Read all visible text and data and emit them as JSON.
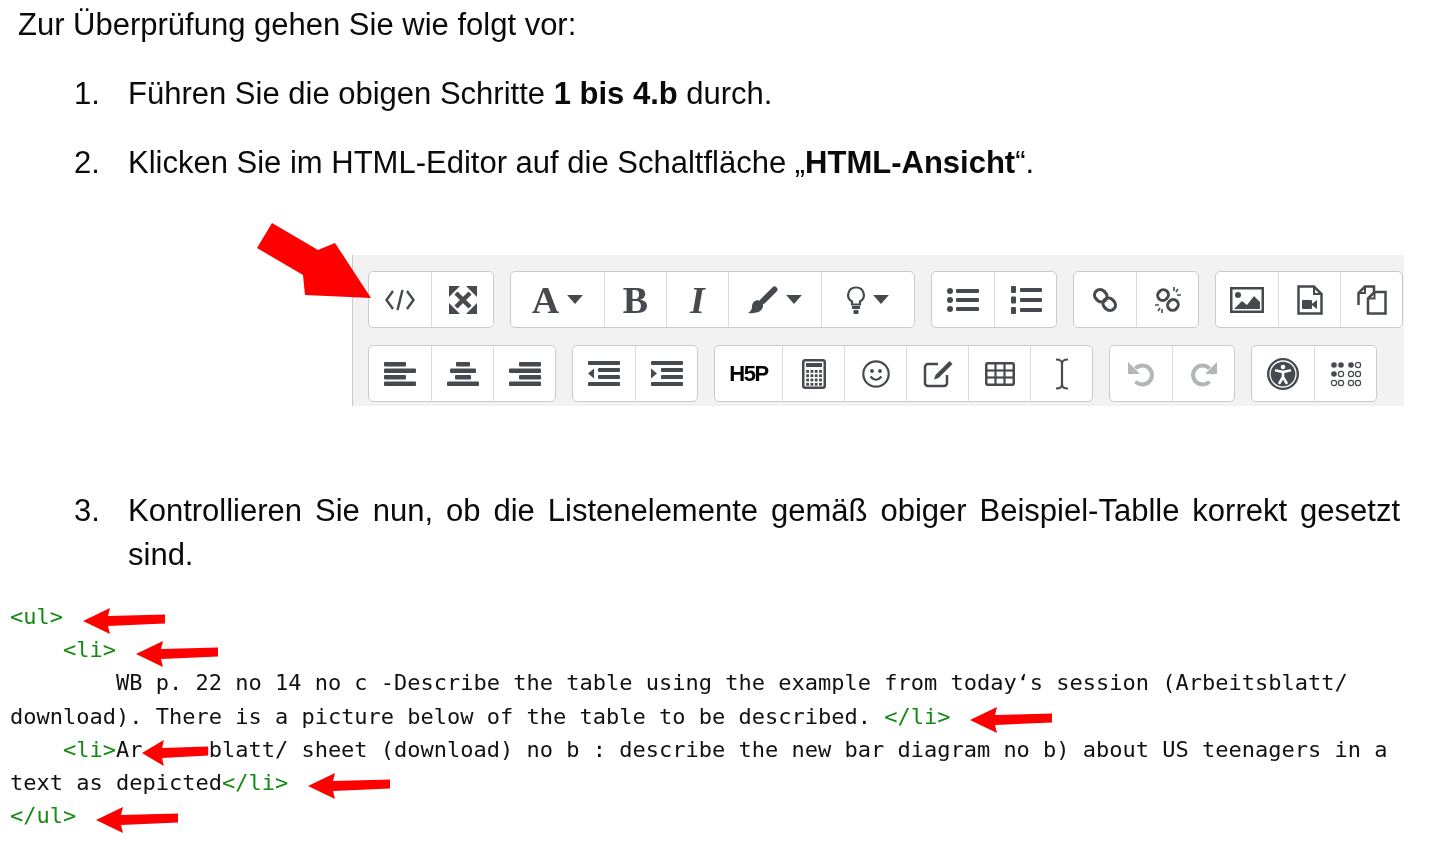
{
  "heading": "Zur Überprüfung gehen Sie wie folgt vor:",
  "steps": [
    {
      "number": "1.",
      "text": "Führen Sie die obigen Schritte **1 bis 4.b** durch."
    },
    {
      "number": "2.",
      "text": "Klicken Sie im HTML-Editor auf die Schaltfläche „**HTML-Ansicht**“.",
      "toolbar": {
        "rows": [
          {
            "groups": [
              {
                "buttons": [
                  {
                    "kind": "icon",
                    "dropdown": false,
                    "disabled": false
                  },
                  {
                    "kind": "icon",
                    "dropdown": false,
                    "disabled": false
                  }
                ]
              },
              {
                "buttons": [
                  {
                    "kind": "glyph",
                    "label": "A",
                    "dropdown": true,
                    "disabled": false
                  },
                  {
                    "kind": "glyph",
                    "label": "B",
                    "dropdown": false,
                    "disabled": false
                  },
                  {
                    "kind": "glyph",
                    "label": "I",
                    "dropdown": false,
                    "disabled": false
                  },
                  {
                    "kind": "icon",
                    "dropdown": true,
                    "disabled": false
                  },
                  {
                    "kind": "icon",
                    "dropdown": true,
                    "disabled": false
                  }
                ]
              },
              {
                "buttons": [
                  {
                    "kind": "icon",
                    "dropdown": false,
                    "disabled": false
                  },
                  {
                    "kind": "icon",
                    "dropdown": false,
                    "disabled": false
                  }
                ]
              },
              {
                "buttons": [
                  {
                    "kind": "icon",
                    "dropdown": false,
                    "disabled": false
                  },
                  {
                    "kind": "icon",
                    "dropdown": false,
                    "disabled": false
                  }
                ]
              },
              {
                "buttons": [
                  {
                    "kind": "icon",
                    "dropdown": false,
                    "disabled": false
                  },
                  {
                    "kind": "icon",
                    "dropdown": false,
                    "disabled": false
                  },
                  {
                    "kind": "icon",
                    "dropdown": false,
                    "disabled": false
                  }
                ]
              }
            ]
          },
          {
            "groups": [
              {
                "buttons": [
                  {
                    "kind": "icon",
                    "dropdown": false,
                    "disabled": false
                  },
                  {
                    "kind": "icon",
                    "dropdown": false,
                    "disabled": false
                  },
                  {
                    "kind": "icon",
                    "dropdown": false,
                    "disabled": false
                  }
                ]
              },
              {
                "buttons": [
                  {
                    "kind": "icon",
                    "dropdown": false,
                    "disabled": false
                  },
                  {
                    "kind": "icon",
                    "dropdown": false,
                    "disabled": false
                  }
                ]
              },
              {
                "buttons": [
                  {
                    "kind": "glyph",
                    "label": "H5P",
                    "dropdown": false,
                    "disabled": false
                  },
                  {
                    "kind": "icon",
                    "dropdown": false,
                    "disabled": false
                  },
                  {
                    "kind": "icon",
                    "dropdown": false,
                    "disabled": false
                  },
                  {
                    "kind": "icon",
                    "dropdown": false,
                    "disabled": false
                  },
                  {
                    "kind": "icon",
                    "dropdown": false,
                    "disabled": false
                  },
                  {
                    "kind": "icon",
                    "dropdown": false,
                    "disabled": false
                  }
                ]
              },
              {
                "buttons": [
                  {
                    "kind": "icon",
                    "dropdown": false,
                    "disabled": true
                  },
                  {
                    "kind": "icon",
                    "dropdown": false,
                    "disabled": true
                  }
                ]
              },
              {
                "buttons": [
                  {
                    "kind": "icon",
                    "dropdown": false,
                    "disabled": false
                  },
                  {
                    "kind": "icon",
                    "dropdown": false,
                    "disabled": false
                  }
                ]
              }
            ]
          }
        ]
      }
    },
    {
      "number": "3.",
      "text": "Kontrollieren Sie nun, ob die Listenelemente gemäß obiger Beispiel-Tablle korrekt gesetzt sind."
    }
  ],
  "code_listing": {
    "lines": [
      {
        "segments": [
          {
            "kind": "tag",
            "text": "<ul>",
            "arrow": true
          }
        ],
        "children": [
          {
            "segments": [
              {
                "kind": "tag",
                "text": "<li>",
                "arrow": true
              }
            ],
            "children": [
              {
                "segments": [
                  {
                    "kind": "text",
                    "text": "WB p. 22 no 14 no c -Describe the table using the example from today‘s session (Arbeitsblatt/",
                    "arrow": false
                  }
                ]
              }
            ]
          }
        ]
      },
      {
        "segments": [
          {
            "kind": "text",
            "text": "download). There is a picture below of the table to be described. ",
            "arrow": false
          },
          {
            "kind": "tag",
            "text": "</li>",
            "arrow": true
          }
        ],
        "children": [
          {
            "segments": [
              {
                "kind": "tag",
                "text": "<li>",
                "arrow": false
              },
              {
                "kind": "text",
                "text": "Ar",
                "arrow": true
              },
              {
                "kind": "text",
                "text": "blatt/ sheet (download) no b : describe the new bar diagram no b) about US teenagers in a",
                "arrow": false
              }
            ]
          }
        ]
      },
      {
        "segments": [
          {
            "kind": "text",
            "text": "text as depicted",
            "arrow": false
          },
          {
            "kind": "tag",
            "text": "</li>",
            "arrow": true
          }
        ]
      },
      {
        "segments": [
          {
            "kind": "tag",
            "text": "</ul>",
            "arrow": true
          }
        ]
      }
    ]
  }
}
